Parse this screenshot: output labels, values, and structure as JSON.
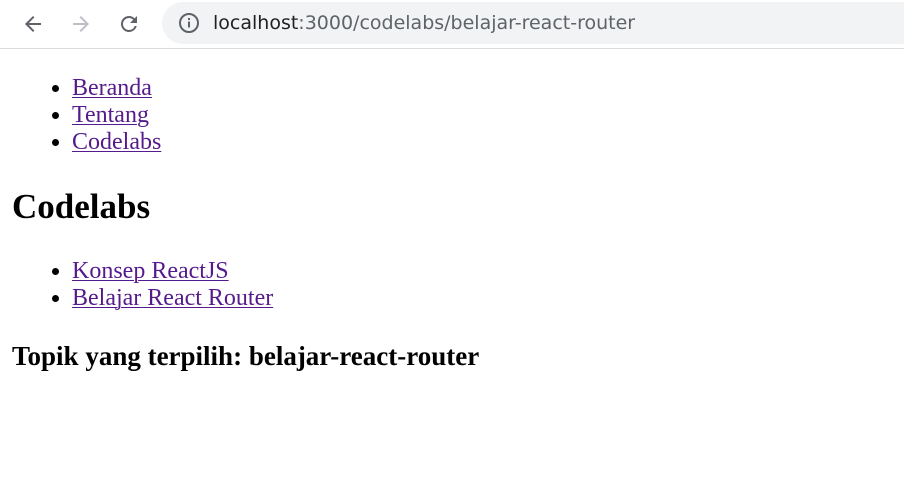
{
  "browser": {
    "url_host": "localhost",
    "url_path": ":3000/codelabs/belajar-react-router"
  },
  "nav": {
    "items": [
      {
        "label": "Beranda"
      },
      {
        "label": "Tentang"
      },
      {
        "label": "Codelabs"
      }
    ]
  },
  "main": {
    "title": "Codelabs",
    "topics": [
      {
        "label": "Konsep ReactJS"
      },
      {
        "label": "Belajar React Router"
      }
    ],
    "selected_topic": "Topik yang terpilih: belajar-react-router"
  },
  "colors": {
    "link": "#551a8b",
    "omnibox_bg": "#f1f3f4",
    "icon_active": "#5f6368",
    "icon_disabled": "#bdc1c6"
  },
  "icons": [
    "back-arrow-icon",
    "forward-arrow-icon",
    "reload-icon",
    "info-icon"
  ]
}
